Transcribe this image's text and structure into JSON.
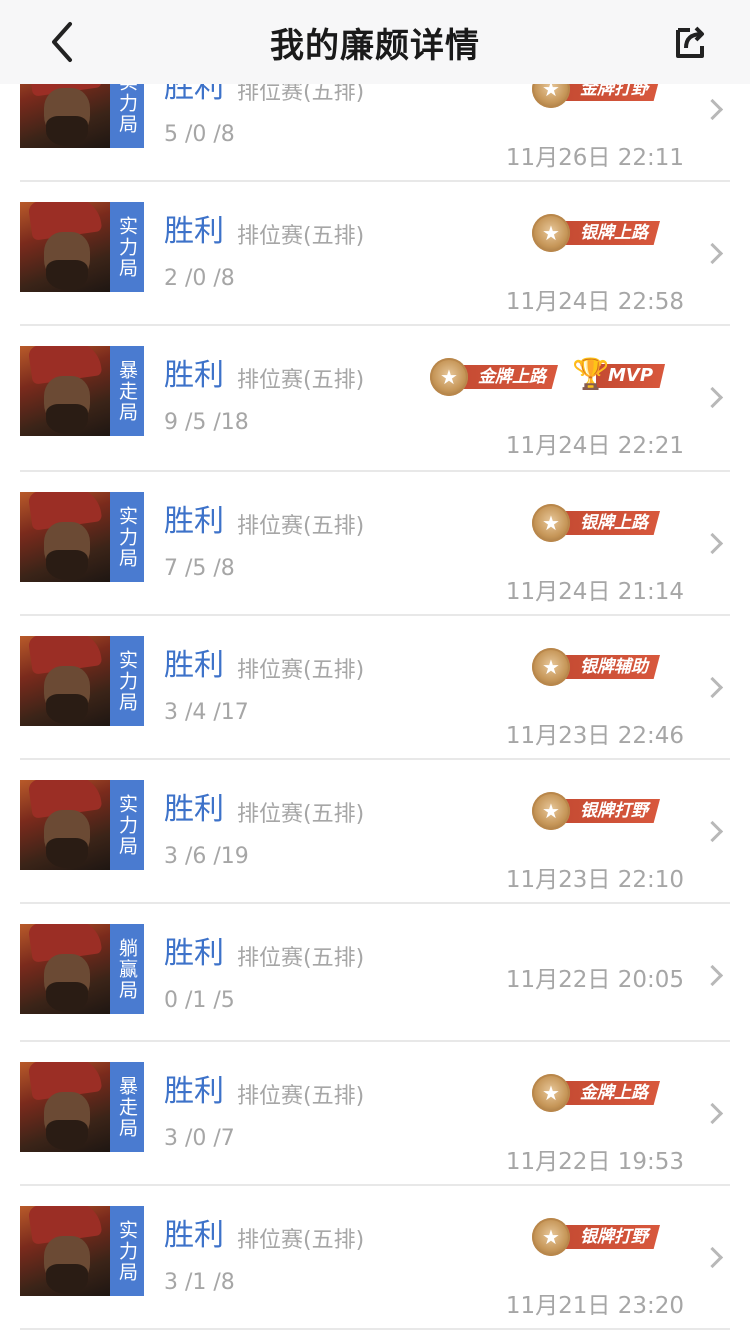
{
  "header": {
    "title": "我的廉颇详情"
  },
  "matches": [
    {
      "tag": "实力局",
      "result": "胜利",
      "mode": "排位赛(五排)",
      "kda": "5 /0 /8",
      "time": "11月26日 22:11",
      "badges": [
        {
          "text": "金牌打野",
          "type": "gold"
        }
      ],
      "mvp": ""
    },
    {
      "tag": "实力局",
      "result": "胜利",
      "mode": "排位赛(五排)",
      "kda": "2 /0 /8",
      "time": "11月24日 22:58",
      "badges": [
        {
          "text": "银牌上路",
          "type": "silver"
        }
      ],
      "mvp": ""
    },
    {
      "tag": "暴走局",
      "result": "胜利",
      "mode": "排位赛(五排)",
      "kda": "9 /5 /18",
      "time": "11月24日 22:21",
      "badges": [
        {
          "text": "金牌上路",
          "type": "gold"
        }
      ],
      "mvp": "MVP"
    },
    {
      "tag": "实力局",
      "result": "胜利",
      "mode": "排位赛(五排)",
      "kda": "7 /5 /8",
      "time": "11月24日 21:14",
      "badges": [
        {
          "text": "银牌上路",
          "type": "silver"
        }
      ],
      "mvp": ""
    },
    {
      "tag": "实力局",
      "result": "胜利",
      "mode": "排位赛(五排)",
      "kda": "3 /4 /17",
      "time": "11月23日 22:46",
      "badges": [
        {
          "text": "银牌辅助",
          "type": "silver"
        }
      ],
      "mvp": ""
    },
    {
      "tag": "实力局",
      "result": "胜利",
      "mode": "排位赛(五排)",
      "kda": "3 /6 /19",
      "time": "11月23日 22:10",
      "badges": [
        {
          "text": "银牌打野",
          "type": "silver"
        }
      ],
      "mvp": ""
    },
    {
      "tag": "躺赢局",
      "result": "胜利",
      "mode": "排位赛(五排)",
      "kda": "0 /1 /5",
      "time": "11月22日 20:05",
      "badges": [],
      "mvp": ""
    },
    {
      "tag": "暴走局",
      "result": "胜利",
      "mode": "排位赛(五排)",
      "kda": "3 /0 /7",
      "time": "11月22日 19:53",
      "badges": [
        {
          "text": "金牌上路",
          "type": "gold"
        }
      ],
      "mvp": ""
    },
    {
      "tag": "实力局",
      "result": "胜利",
      "mode": "排位赛(五排)",
      "kda": "3 /1 /8",
      "time": "11月21日 23:20",
      "badges": [
        {
          "text": "银牌打野",
          "type": "silver"
        }
      ],
      "mvp": ""
    }
  ],
  "colors": {
    "accent": "#3d72c9",
    "tag_bg": "#4a7bd0",
    "badge_red": "#d8583d",
    "medal_gold": "#c69658"
  }
}
